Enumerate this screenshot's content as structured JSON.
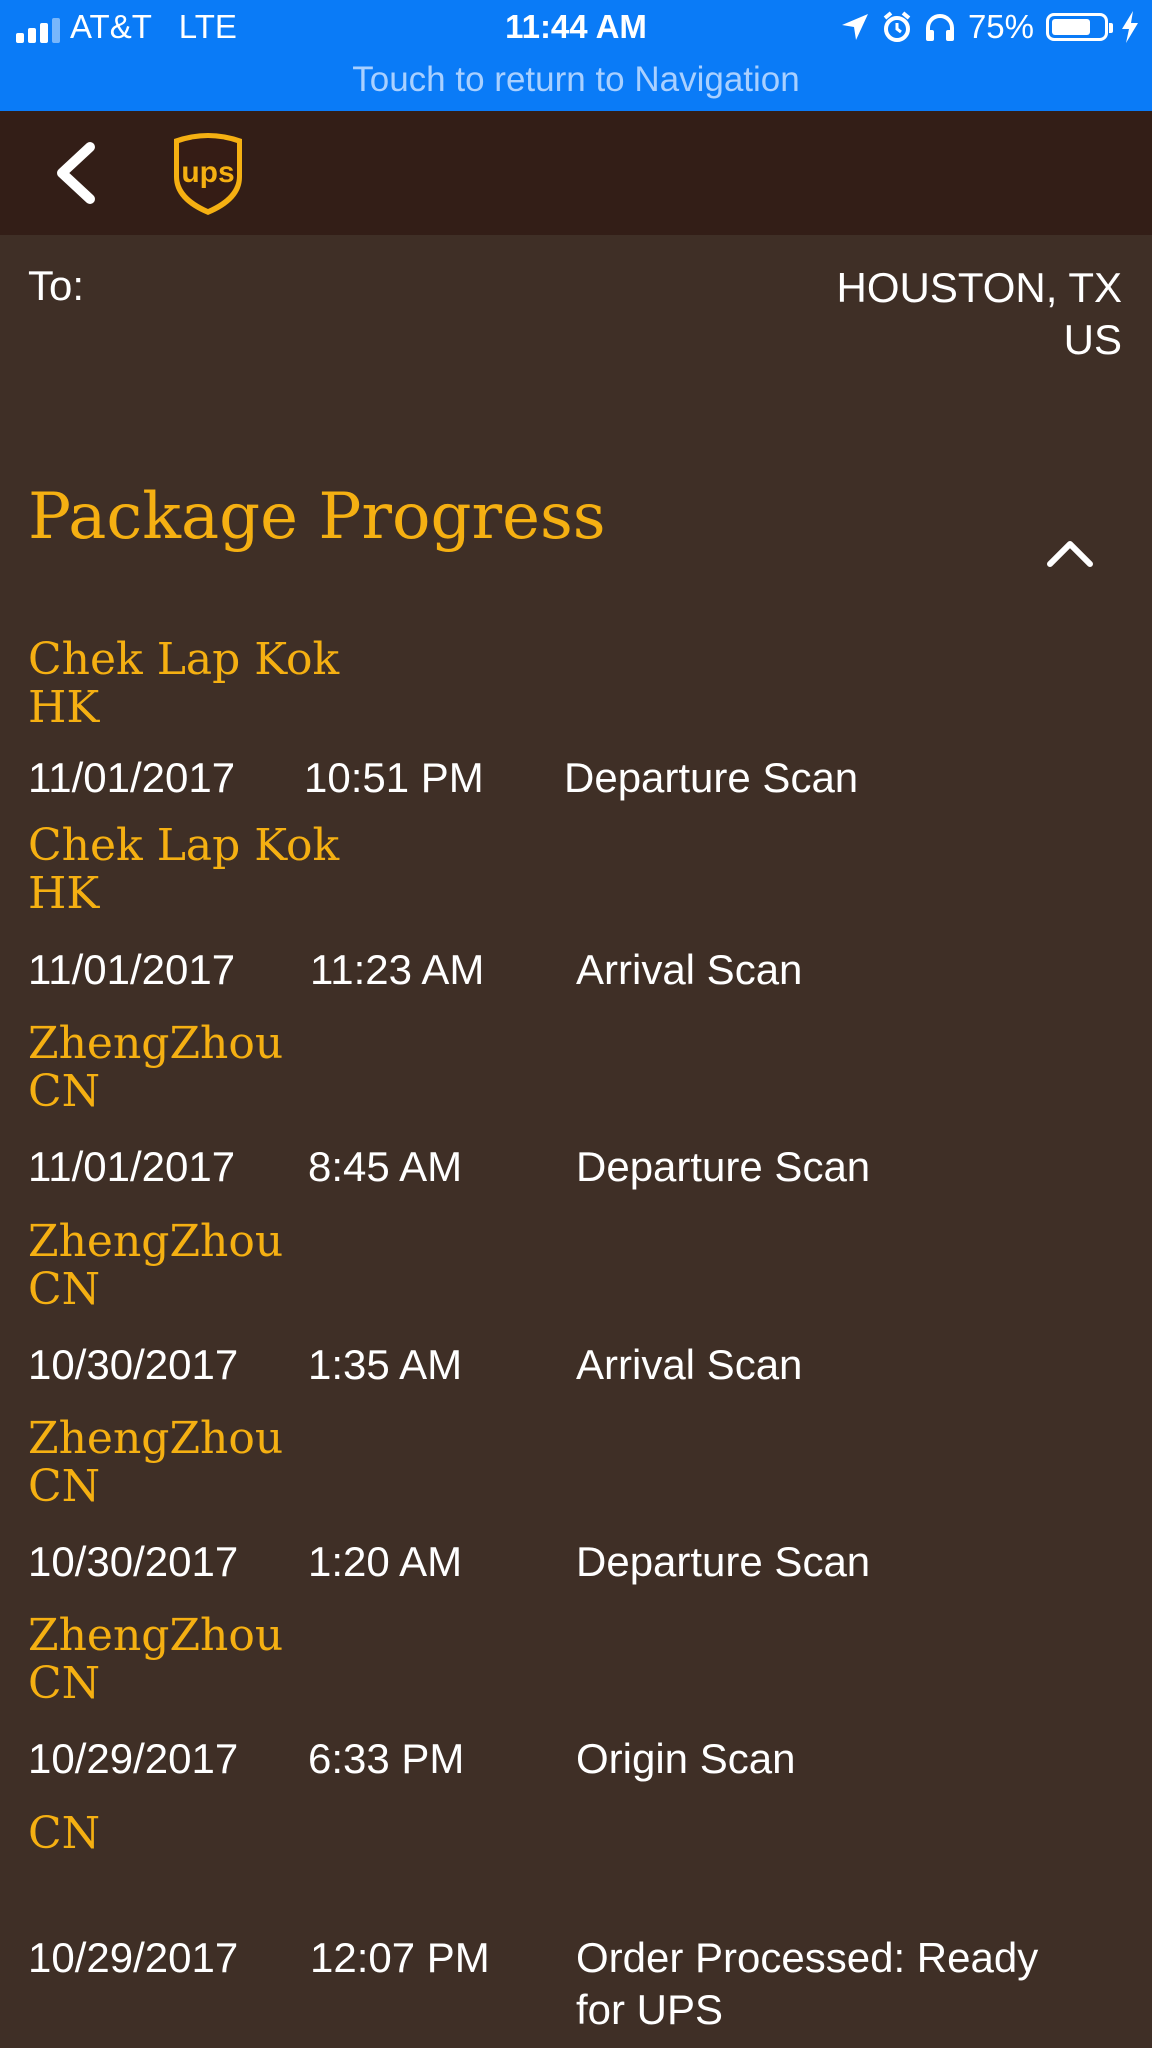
{
  "status_bar": {
    "carrier": "AT&T   LTE",
    "time": "11:44 AM",
    "battery": "75%",
    "battery_level": 0.75,
    "return_text": "Touch to return to Navigation",
    "icons": [
      "location-arrow-icon",
      "alarm-icon",
      "headphones-icon",
      "charging-bolt-icon"
    ]
  },
  "header": {
    "back_icon": "chevron-left-icon",
    "logo": "ups"
  },
  "destination": {
    "label": "To:",
    "line1": "HOUSTON, TX",
    "line2": "US"
  },
  "progress": {
    "title": "Package Progress",
    "toggle_icon": "chevron-up-icon",
    "events": [
      {
        "city": "Chek Lap Kok",
        "country": "HK",
        "date": "11/01/2017",
        "time": "10:51 PM",
        "activity": "Departure Scan"
      },
      {
        "city": "Chek Lap Kok",
        "country": "HK",
        "date": "11/01/2017",
        "time": "11:23 AM",
        "activity": "Arrival Scan"
      },
      {
        "city": "ZhengZhou",
        "country": "CN",
        "date": "11/01/2017",
        "time": "8:45 AM",
        "activity": "Departure Scan"
      },
      {
        "city": "ZhengZhou",
        "country": "CN",
        "date": "10/30/2017",
        "time": "1:35 AM",
        "activity": "Arrival Scan"
      },
      {
        "city": "ZhengZhou",
        "country": "CN",
        "date": "10/30/2017",
        "time": "1:20 AM",
        "activity": "Departure Scan"
      },
      {
        "city": "ZhengZhou",
        "country": "CN",
        "date": "10/29/2017",
        "time": "6:33 PM",
        "activity": "Origin Scan"
      },
      {
        "city": "",
        "country": "CN",
        "date": "10/29/2017",
        "time": "12:07 PM",
        "activity_line1": "Order Processed: Ready",
        "activity_line2": "for UPS"
      }
    ]
  },
  "colors": {
    "status_bar": "#0a7bf7",
    "header": "#331e17",
    "background": "#3f2f26",
    "accent": "#f5b012"
  }
}
